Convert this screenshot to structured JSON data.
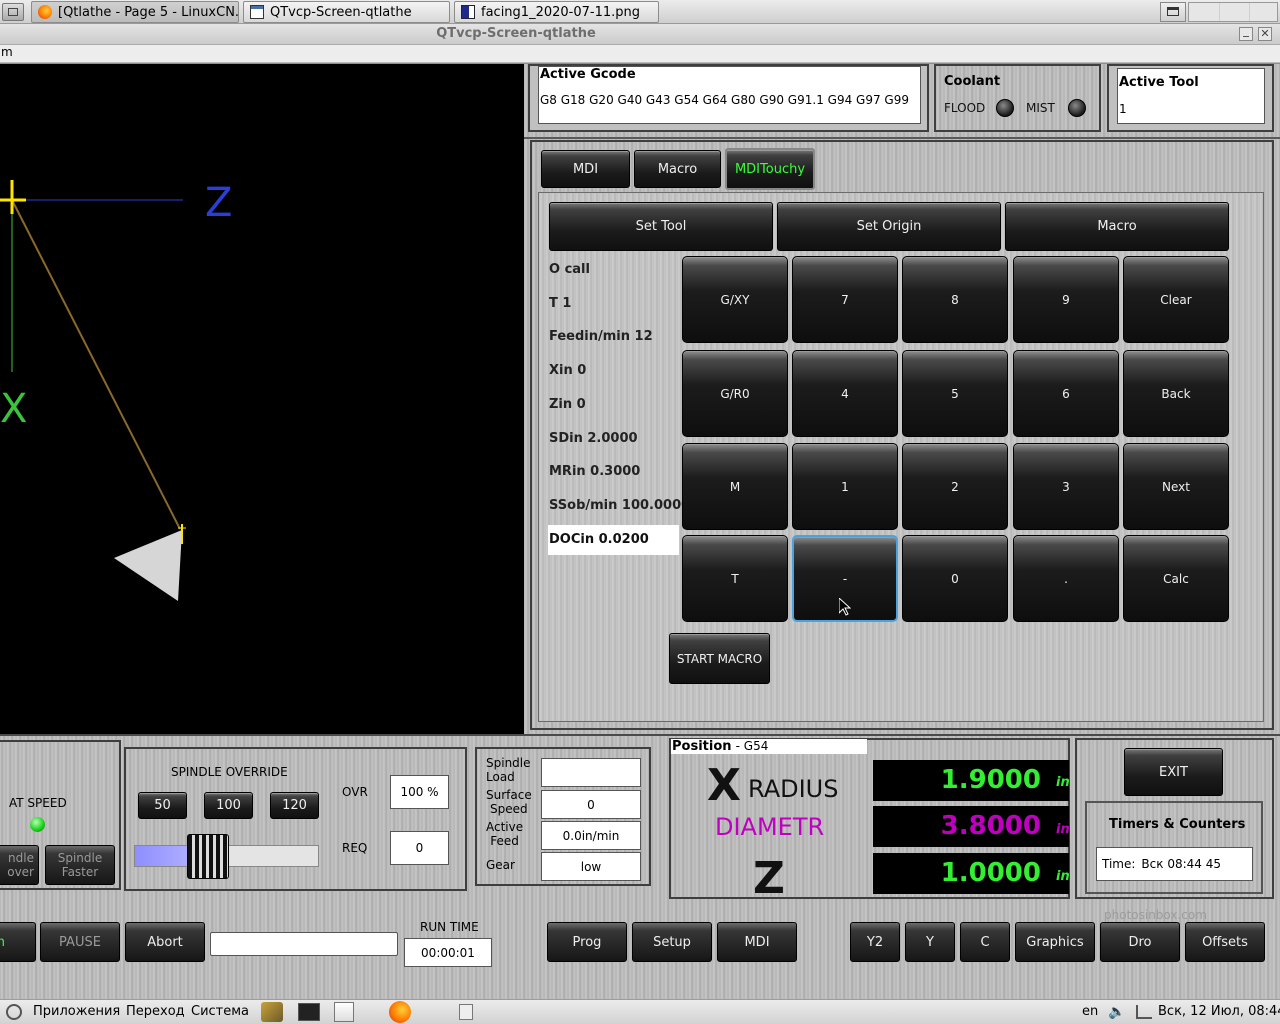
{
  "taskbar": {
    "tabs": [
      {
        "label": "[Qtlathe - Page 5 - LinuxCN...",
        "icon": "firefox-icon"
      },
      {
        "label": "QTvcp-Screen-qtlathe",
        "icon": "window-icon"
      },
      {
        "label": "facing1_2020-07-11.png",
        "icon": "image-icon"
      }
    ]
  },
  "window": {
    "title": "QTvcp-Screen-qtlathe",
    "menu_fragment": "m"
  },
  "graphics": {
    "z_label": "Z",
    "x_label": "X"
  },
  "gcode": {
    "title": "Active Gcode",
    "codes": "G8 G18 G20 G40 G43 G54 G64 G80 G90 G91.1 G94 G97 G99"
  },
  "coolant": {
    "title": "Coolant",
    "flood": "FLOOD",
    "mist": "MIST"
  },
  "tool": {
    "title": "Active Tool",
    "value": "1"
  },
  "tabs": [
    {
      "label": "MDI",
      "active": false
    },
    {
      "label": "Macro",
      "active": false
    },
    {
      "label": "MDITouchy",
      "active": true
    }
  ],
  "touchy": {
    "top_buttons": [
      "Set Tool",
      "Set Origin",
      "Macro"
    ],
    "fields": [
      "O call",
      "T 1",
      "Feedin/min 12",
      "Xin 0",
      "Zin 0",
      "SDin 2.0000",
      "MRin 0.3000",
      "SSob/min 100.0000",
      "DOCin 0.0200"
    ],
    "keypad": [
      [
        "G/XY",
        "7",
        "8",
        "9",
        "Clear"
      ],
      [
        "G/R0",
        "4",
        "5",
        "6",
        "Back"
      ],
      [
        "M",
        "1",
        "2",
        "3",
        "Next"
      ],
      [
        "T",
        "-",
        "0",
        ".",
        "Calc"
      ]
    ],
    "start_macro": "START MACRO"
  },
  "spindle": {
    "at_speed": "AT SPEED",
    "slower_fragment": "ndle\nover",
    "faster": "Spindle\nFaster",
    "override_title": "SPINDLE OVERRIDE",
    "presets": [
      "50",
      "100",
      "120"
    ],
    "ovr_label": "OVR",
    "ovr_value": "100 %",
    "req_label": "REQ",
    "req_value": "0",
    "override_fraction": 0.39
  },
  "status": {
    "load_label": "Spindle\nLoad",
    "load_value": "",
    "surface_label": "Surface\nSpeed",
    "surface_value": "0",
    "feed_label": "Active\nFeed",
    "feed_value": "0.0in/min",
    "gear_label": "Gear",
    "gear_value": "low"
  },
  "position": {
    "title": "Position",
    "coord_system": "- G54",
    "axis_x": "X",
    "radius_label": "RADIUS",
    "diameter_label": "DIAMETR",
    "axis_z": "Z",
    "x_value": "1.9000",
    "dia_value": "3.8000",
    "z_value": "1.0000",
    "unit": "in"
  },
  "right": {
    "exit": "EXIT",
    "timers_title": "Timers & Counters",
    "time_label": "Time:",
    "time_value": "Вск 08:44 45"
  },
  "bottom": {
    "run_fragment": "n",
    "pause": "PAUSE",
    "abort": "Abort",
    "run_time_label": "RUN TIME",
    "run_time_value": "00:00:01",
    "nav": [
      "Prog",
      "Setup",
      "MDI"
    ],
    "views": [
      "Y2",
      "Y",
      "C",
      "Graphics",
      "Dro",
      "Offsets"
    ],
    "watermark": "photosinbox.com"
  },
  "system_bar": {
    "apps": "Приложения",
    "places": "Переход",
    "system": "Система",
    "lang": "en",
    "datetime": "Вск, 12 Июл, 08:44"
  },
  "colors": {
    "dro_green": "#33ee33",
    "diameter_magenta": "#c000c0",
    "active_tab_text": "#37ff37"
  }
}
